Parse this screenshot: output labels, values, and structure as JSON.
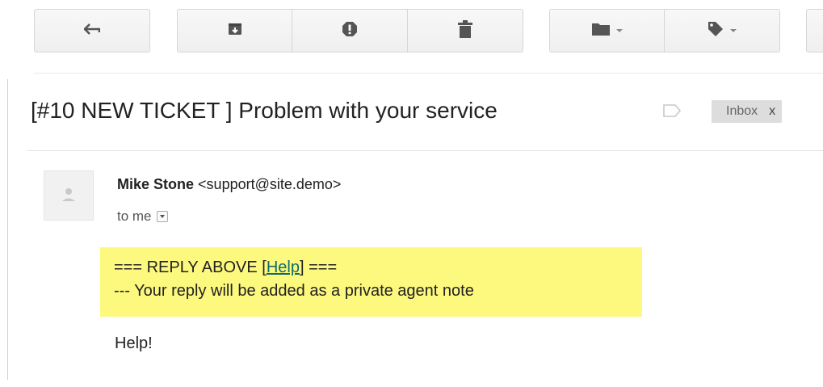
{
  "toolbar": {
    "buttons": [
      {
        "name": "back-button",
        "icon": "reply-arrow-icon"
      },
      {
        "name": "archive-button",
        "icon": "archive-icon"
      },
      {
        "name": "report-spam-button",
        "icon": "spam-exclamation-icon"
      },
      {
        "name": "delete-button",
        "icon": "trash-icon"
      },
      {
        "name": "move-to-button",
        "icon": "folder-icon"
      },
      {
        "name": "labels-button",
        "icon": "tag-icon"
      }
    ]
  },
  "subject": {
    "text": "[#10 NEW TICKET ] Problem with your service",
    "label_chip": "Inbox",
    "label_remove": "x"
  },
  "message": {
    "sender_name": "Mike Stone",
    "sender_email": "<support@site.demo>",
    "to_text": "to me",
    "highlight": {
      "line1_prefix": "=== REPLY ABOVE [",
      "line1_link": "Help",
      "line1_suffix": "] ===",
      "line2": "--- Your reply will be added as a private agent note"
    },
    "body": "Help!"
  },
  "colors": {
    "highlight": "#fdf97e",
    "link": "#0f6b6b",
    "chip_bg": "#dddddd"
  }
}
